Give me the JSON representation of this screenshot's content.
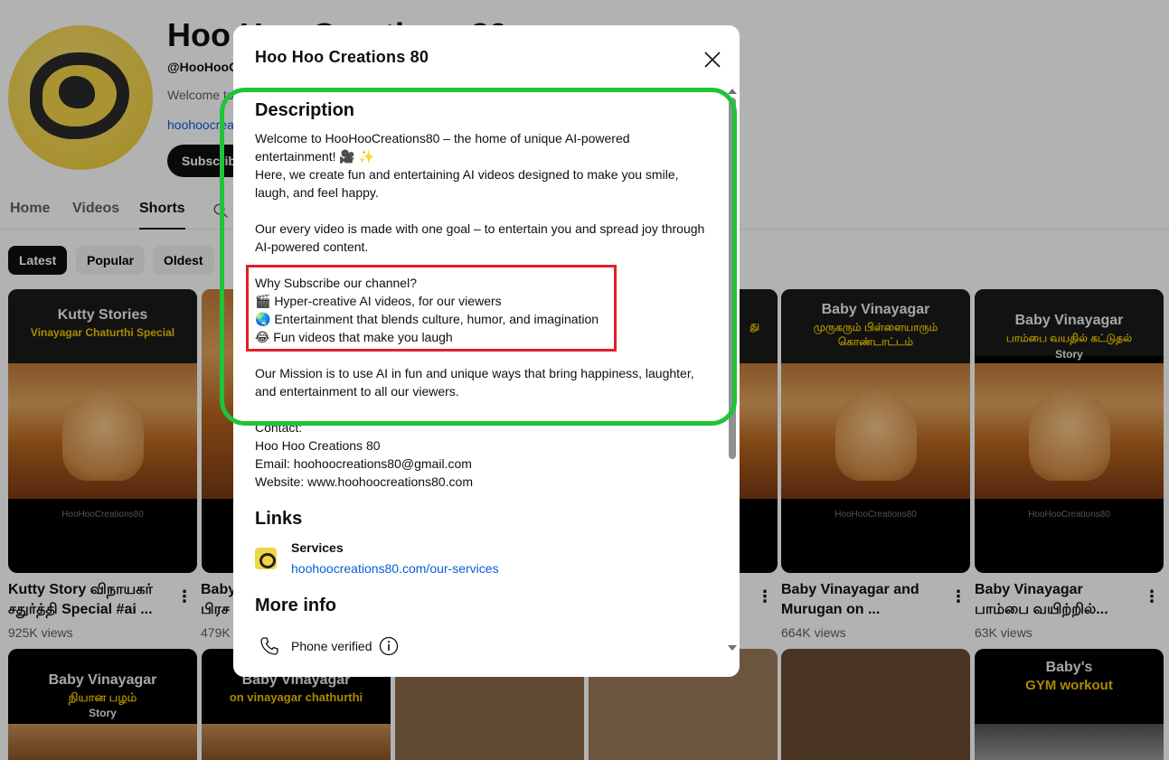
{
  "channel": {
    "title": "Hoo Hoo Creations 80",
    "handle": "@HooHooC",
    "description_snippet": "Welcome to",
    "link_snippet": "hoohoocrea",
    "subscribe_label": "Subscribe"
  },
  "tabs": [
    {
      "label": "Home"
    },
    {
      "label": "Videos"
    },
    {
      "label": "Shorts"
    }
  ],
  "chips": [
    {
      "label": "Latest"
    },
    {
      "label": "Popular"
    },
    {
      "label": "Oldest"
    }
  ],
  "cards": [
    {
      "l1": "Kutty Stories",
      "l2": "Vinayagar Chaturthi Special",
      "l3": "",
      "wm": "HooHooCreations80",
      "title": "Kutty Story விநாயகர் சதுர்த்தி Special #ai ...",
      "views": "925K views"
    },
    {
      "l1": "",
      "l2": "",
      "l3": "",
      "wm": "",
      "title": "Baby பிரச",
      "views": "479K"
    },
    {
      "l1": "",
      "l2": "",
      "l3": "",
      "wm": "",
      "title": "",
      "views": ""
    },
    {
      "l1": "",
      "l2": "து",
      "l3": "",
      "wm": "",
      "title": "",
      "views": ""
    },
    {
      "l1": "Baby Vinayagar",
      "l2": "முருகரும் பிள்ளையாரும் கொண்டாட்டம்",
      "l3": "",
      "wm": "HooHooCreations80",
      "title": "Baby Vinayagar and Murugan on ...",
      "views": "664K views"
    },
    {
      "l1": "Baby Vinayagar",
      "l2": "பாம்பை வயதில் கட்டுதல்",
      "l3": "Story",
      "wm": "HooHooCreations80",
      "title": "Baby Vinayagar பாம்பை வயிற்றில்...",
      "views": "63K views"
    }
  ],
  "row2_cards": [
    {
      "l1": "Baby Vinayagar",
      "l2": "நியான பழம்",
      "l3": "Story"
    },
    {
      "l1": "Baby Vinayagar",
      "l2": "on vinayagar chathurthi",
      "l3": ""
    },
    {
      "l1": "",
      "l2": "",
      "l3": ""
    },
    {
      "l1": "",
      "l2": "",
      "l3": ""
    },
    {
      "l1": "",
      "l2": "",
      "l3": ""
    },
    {
      "l1": "Baby's",
      "l2": "GYM workout",
      "l3": ""
    }
  ],
  "dialog": {
    "title": "Hoo Hoo Creations 80",
    "description_heading": "Description",
    "desc_lines": [
      "Welcome to HooHooCreations80 – the home of unique AI-powered",
      "entertainment! 🎥 ✨",
      "Here, we create fun and entertaining AI videos designed to make you smile,",
      "laugh, and feel happy.",
      "",
      "Our every video is made with one goal – to entertain you and spread joy through",
      "AI-powered content.",
      "",
      "Why Subscribe our channel?",
      "🎬 Hyper-creative AI videos, for our viewers",
      "🌏 Entertainment that blends culture, humor, and imagination",
      "😂 Fun videos that make you laugh",
      "",
      "Our Mission is to use AI in fun and unique ways that bring happiness, laughter,",
      "and entertainment to all our viewers.",
      "",
      "Contact:",
      "Hoo Hoo Creations 80",
      "Email: hoohoocreations80@gmail.com",
      "Website: www.hoohoocreations80.com"
    ],
    "links_heading": "Links",
    "link_name": "Services",
    "link_url": "hoohoocreations80.com/our-services",
    "more_info_heading": "More info",
    "phone_label": "Phone verified"
  },
  "colors": {
    "accent_link": "#065fd4",
    "highlight_green": "#1ec43a",
    "highlight_red": "#e0202a"
  }
}
